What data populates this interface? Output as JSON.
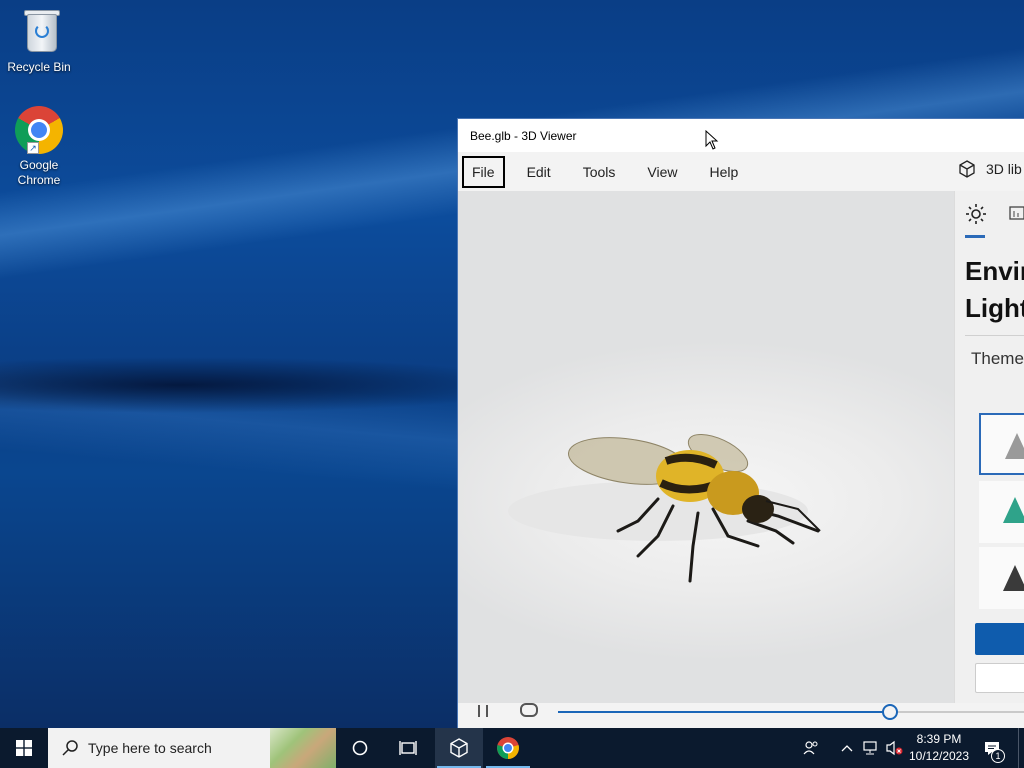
{
  "desktop": {
    "icons": [
      {
        "label": "Recycle Bin"
      },
      {
        "label": "Google Chrome",
        "label_line1": "Google",
        "label_line2": "Chrome"
      }
    ]
  },
  "window": {
    "title": "Bee.glb - 3D Viewer",
    "menu": [
      "File",
      "Edit",
      "Tools",
      "View",
      "Help"
    ],
    "focused_menu": "File",
    "library_button": "3D lib",
    "model_icon": "bee-model",
    "panel": {
      "title_line1": "Envir",
      "title_line2": "Light",
      "theme_label": "Theme",
      "theme_colors": [
        "#9a9a9a",
        "#2fa38a",
        "#3a3a3a"
      ]
    },
    "animation": {
      "progress": 0.71
    }
  },
  "taskbar": {
    "search_placeholder": "Type here to search",
    "clock_time": "8:39 PM",
    "clock_date": "10/12/2023",
    "notification_count": "1",
    "accent": "#76b9ed"
  }
}
